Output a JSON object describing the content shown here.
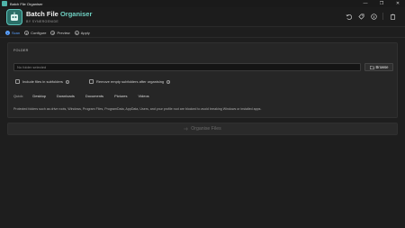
{
  "window": {
    "title": "Batch File Organiser",
    "controls": [
      "—",
      "❐",
      "✕"
    ]
  },
  "header": {
    "brand_main": "Batch File ",
    "brand_accent": "Organiser",
    "subtitle": "BY SYNERGENIDE",
    "icons": [
      "undo-icon",
      "tag-icon",
      "info-icon",
      "clipboard-icon"
    ]
  },
  "steps": [
    {
      "num": "1",
      "label": "Scan",
      "active": true
    },
    {
      "num": "2",
      "label": "Configure",
      "active": false
    },
    {
      "num": "3",
      "label": "Preview",
      "active": false
    },
    {
      "num": "4",
      "label": "Apply",
      "active": false
    }
  ],
  "panel": {
    "label": "FOLDER",
    "folder_value": "No folder selected",
    "browse_label": "Browse",
    "include_subfolders_label": "Include files in subfolders",
    "remove_empty_label": "Remove empty subfolders after organising",
    "quick_label": "Quick:",
    "quick_items": [
      "Desktop",
      "Downloads",
      "Documents",
      "Pictures",
      "Videos"
    ],
    "note": "Protected folders such as drive roots, Windows, Program Files, ProgramData, AppData, Users, and your profile root are blocked to avoid breaking Windows or installed apps."
  },
  "organise_button": "Organise Files",
  "colors": {
    "accent": "#5aa0ff",
    "brand_accent": "#6fd0c2",
    "background": "#1e1e1e"
  }
}
